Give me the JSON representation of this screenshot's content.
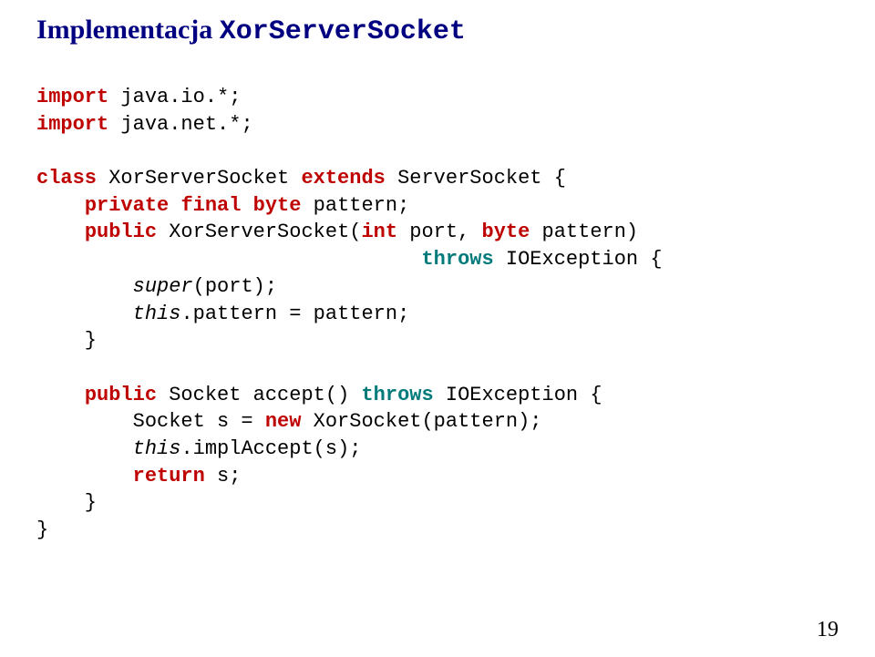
{
  "title": {
    "prefix": "Implementacja ",
    "codeName": "XorServerSocket"
  },
  "code": {
    "line1_kw": "import",
    "line1_rest": " java.io.*;",
    "line2_kw": "import",
    "line2_rest": " java.net.*;",
    "line3_kw1": "class",
    "line3_mid": " XorServerSocket ",
    "line3_kw2": "extends",
    "line3_rest": " ServerSocket {",
    "line4_ind": "    ",
    "line4_kw1": "private",
    "line4_sp": " ",
    "line4_kw2": "final",
    "line4_sp2": " ",
    "line4_kw3": "byte",
    "line4_rest": " pattern;",
    "line5_ind": "    ",
    "line5_kw1": "public",
    "line5_mid": " XorServerSocket(",
    "line5_kw2": "int",
    "line5_mid2": " port, ",
    "line5_kw3": "byte",
    "line5_rest": " pattern)",
    "line6_ind": "                                ",
    "line6_kw": "throws",
    "line6_rest": " IOException {",
    "line7_ind": "        ",
    "line7_kw": "super",
    "line7_rest": "(port);",
    "line8_ind": "        ",
    "line8_kw": "this",
    "line8_rest": ".pattern = pattern;",
    "line9": "    }",
    "line10_ind": "    ",
    "line10_kw1": "public",
    "line10_mid": " Socket accept() ",
    "line10_kw2": "throws",
    "line10_rest": " IOException {",
    "line11_ind": "        Socket s = ",
    "line11_kw": "new",
    "line11_rest": " XorSocket(pattern);",
    "line12_ind": "        ",
    "line12_kw": "this",
    "line12_rest": ".implAccept(s);",
    "line13_ind": "        ",
    "line13_kw": "return",
    "line13_rest": " s;",
    "line14": "    }",
    "line15": "}"
  },
  "pageNumber": "19"
}
